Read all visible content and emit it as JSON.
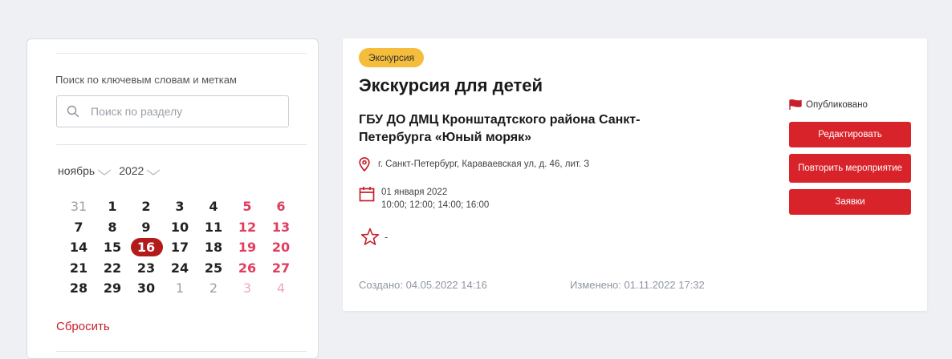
{
  "sidebar": {
    "search_label": "Поиск по ключевым словам и меткам",
    "search_placeholder": "Поиск по разделу",
    "month": "ноябрь",
    "year": "2022",
    "reset_label": "Сбросить",
    "calendar_days": [
      {
        "t": "31",
        "out": true,
        "we": false
      },
      {
        "t": "1",
        "out": false,
        "we": false
      },
      {
        "t": "2",
        "out": false,
        "we": false
      },
      {
        "t": "3",
        "out": false,
        "we": false
      },
      {
        "t": "4",
        "out": false,
        "we": false
      },
      {
        "t": "5",
        "out": false,
        "we": true
      },
      {
        "t": "6",
        "out": false,
        "we": true
      },
      {
        "t": "7",
        "out": false,
        "we": false
      },
      {
        "t": "8",
        "out": false,
        "we": false
      },
      {
        "t": "9",
        "out": false,
        "we": false
      },
      {
        "t": "10",
        "out": false,
        "we": false
      },
      {
        "t": "11",
        "out": false,
        "we": false
      },
      {
        "t": "12",
        "out": false,
        "we": true
      },
      {
        "t": "13",
        "out": false,
        "we": true
      },
      {
        "t": "14",
        "out": false,
        "we": false
      },
      {
        "t": "15",
        "out": false,
        "we": false
      },
      {
        "t": "16",
        "out": false,
        "we": false,
        "today": true
      },
      {
        "t": "17",
        "out": false,
        "we": false
      },
      {
        "t": "18",
        "out": false,
        "we": false
      },
      {
        "t": "19",
        "out": false,
        "we": true
      },
      {
        "t": "20",
        "out": false,
        "we": true
      },
      {
        "t": "21",
        "out": false,
        "we": false
      },
      {
        "t": "22",
        "out": false,
        "we": false
      },
      {
        "t": "23",
        "out": false,
        "we": false
      },
      {
        "t": "24",
        "out": false,
        "we": false
      },
      {
        "t": "25",
        "out": false,
        "we": false
      },
      {
        "t": "26",
        "out": false,
        "we": true
      },
      {
        "t": "27",
        "out": false,
        "we": true
      },
      {
        "t": "28",
        "out": false,
        "we": false
      },
      {
        "t": "29",
        "out": false,
        "we": false
      },
      {
        "t": "30",
        "out": false,
        "we": false
      },
      {
        "t": "1",
        "out": true,
        "we": false
      },
      {
        "t": "2",
        "out": true,
        "we": false
      },
      {
        "t": "3",
        "out": true,
        "we": true
      },
      {
        "t": "4",
        "out": true,
        "we": true
      }
    ]
  },
  "event": {
    "badge": "Экскурсия",
    "title": "Экскурсия для детей",
    "organization": "ГБУ ДО ДМЦ Кронштадтского района Санкт-Петербурга «Юный моряк»",
    "address": "г. Санкт-Петербург, Караваевская ул, д. 46, лит. З",
    "date": "01 января 2022",
    "times": "10:00; 12:00; 14:00; 16:00",
    "rating": "-",
    "created": "Создано: 04.05.2022 14:16",
    "modified": "Изменено: 01.11.2022 17:32",
    "status": "Опубликовано",
    "buttons": {
      "edit": "Редактировать",
      "repeat": "Повторить мероприятие",
      "requests": "Заявки"
    }
  },
  "colors": {
    "accent_red": "#d8232a",
    "today_red": "#b31b1b",
    "weekend_pink": "#e13d5c",
    "badge_yellow": "#f5bd3b",
    "background": "#eef0f4"
  }
}
